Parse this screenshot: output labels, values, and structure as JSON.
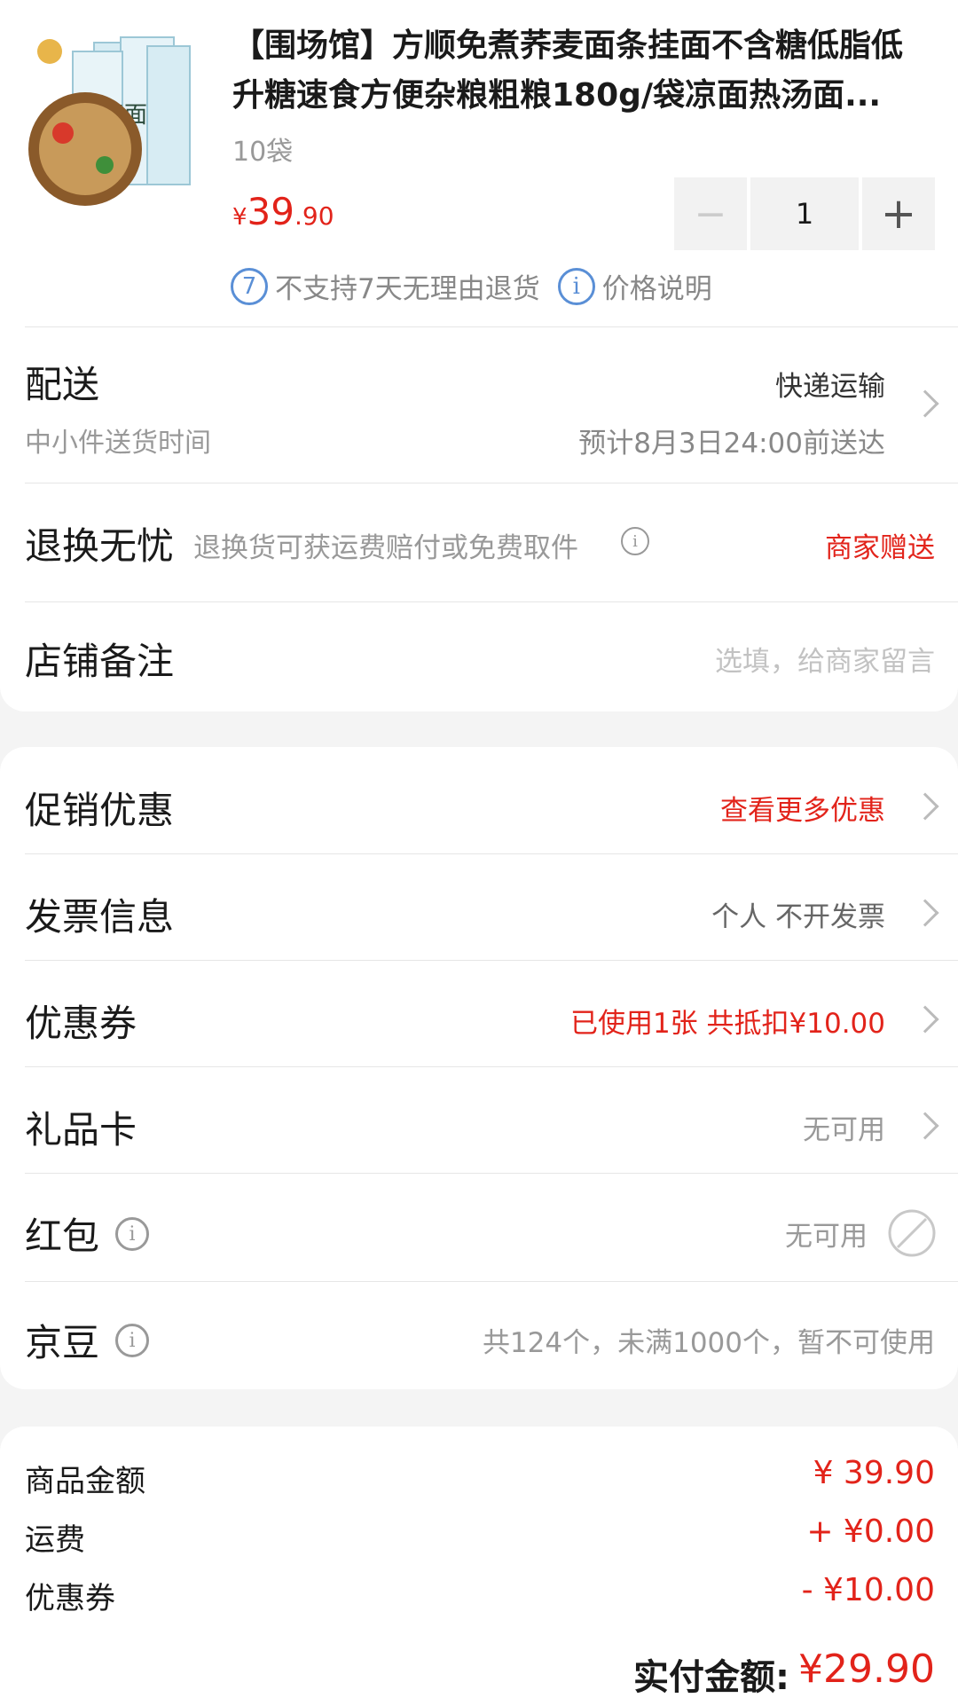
{
  "product": {
    "title": "【围场馆】方顺免煮荞麦面条挂面不含糖低脂低升糖速食方便杂粮粗粮180g/袋凉面热汤面...",
    "spec": "10袋",
    "price_symbol": "¥",
    "price_int": "39",
    "price_dec": ".90",
    "quantity": "1",
    "minus_label": "−",
    "plus_label": "+",
    "note_no_return": "不支持7天无理由退货",
    "note_price": "价格说明",
    "thumb_text": "荞麦面"
  },
  "delivery": {
    "title": "配送",
    "subtitle": "中小件送货时间",
    "method": "快递运输",
    "eta": "预计8月3日24:00前送达"
  },
  "return_service": {
    "title": "退换无忧",
    "desc": "退换货可获运费赔付或免费取件",
    "value": "商家赠送"
  },
  "store_note": {
    "title": "店铺备注",
    "placeholder": "选填，给商家留言"
  },
  "promotion": {
    "title": "促销优惠",
    "value": "查看更多优惠"
  },
  "invoice": {
    "title": "发票信息",
    "value": "个人 不开发票"
  },
  "coupon": {
    "title": "优惠券",
    "value": "已使用1张 共抵扣¥10.00"
  },
  "gift_card": {
    "title": "礼品卡",
    "value": "无可用"
  },
  "red_packet": {
    "title": "红包",
    "value": "无可用"
  },
  "jd_beans": {
    "title": "京豆",
    "value": "共124个，未满1000个，暂不可使用"
  },
  "summary": {
    "goods_label": "商品金额",
    "goods_value": "¥ 39.90",
    "shipping_label": "运费",
    "shipping_value": "+ ¥0.00",
    "coupon_label": "优惠券",
    "coupon_value": "- ¥10.00",
    "total_label": "实付金额:",
    "total_value": "¥29.90"
  },
  "colors": {
    "accent": "#e2231a",
    "info_blue": "#5a8fd6",
    "bg": "#f4f4f4"
  }
}
